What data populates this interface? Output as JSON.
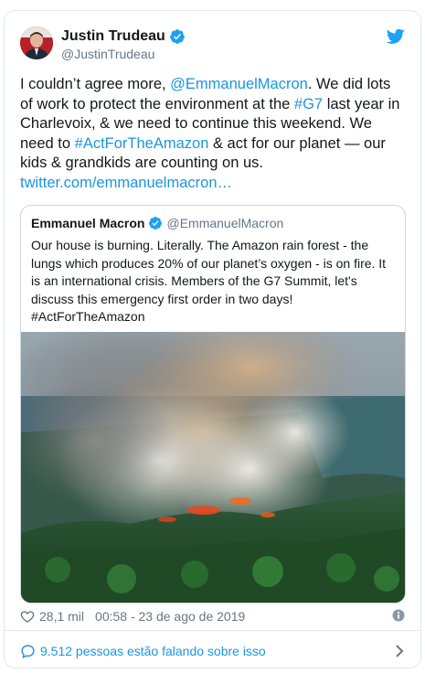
{
  "author": {
    "name": "Justin Trudeau",
    "handle": "@JustinTrudeau"
  },
  "tweet": {
    "t1": "I couldn’t agree more, ",
    "mention": "@EmmanuelMacron",
    "t2": ". We did lots of work to protect the environment at the ",
    "hashtag1": "#G7",
    "t3": " last year in Charlevoix, & we need to continue this weekend. We need to ",
    "hashtag2": "#ActForTheAmazon",
    "t4": " & act for our planet — our kids & grandkids are counting on us. ",
    "url": "twitter.com/emmanuelmacron…"
  },
  "quote": {
    "name": "Emmanuel Macron",
    "handle": "@EmmanuelMacron",
    "text": "Our house is burning. Literally. The Amazon rain forest - the lungs which produces 20% of our planet’s oxygen - is on fire. It is an international crisis. Members of the G7 Summit, let's discuss this emergency first order in two days! #ActForTheAmazon"
  },
  "footer": {
    "likes": "28,1 mil",
    "timestamp": "00:58 - 23 de ago de 2019"
  },
  "conversation": {
    "label": "9.512 pessoas estão falando sobre isso"
  },
  "colors": {
    "link": "#1b95e0",
    "verified": "#1da1f2",
    "muted": "#657786"
  }
}
